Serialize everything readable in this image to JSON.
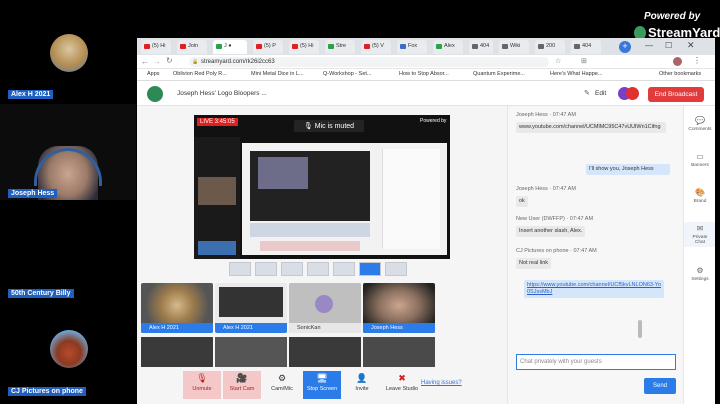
{
  "overlay": {
    "powered_by": "Powered by",
    "brand": "StreamYard"
  },
  "participants": [
    {
      "name": "Alex H 2021"
    },
    {
      "name": "Joseph Hess"
    },
    {
      "name": "50th Century Billy"
    },
    {
      "name": "CJ Pictures on phone"
    }
  ],
  "browser": {
    "tabs": [
      {
        "label": "(5) Hi",
        "fav": "#e02020"
      },
      {
        "label": "Join",
        "fav": "#e02020"
      },
      {
        "label": "J ●",
        "fav": "#2aa14b"
      },
      {
        "label": "(5) P",
        "fav": "#e02020"
      },
      {
        "label": "(5) Hi",
        "fav": "#e02020"
      },
      {
        "label": "Stre",
        "fav": "#2aa14b"
      },
      {
        "label": "(5) V",
        "fav": "#e02020"
      },
      {
        "label": "Fox",
        "fav": "#3a6cc7"
      },
      {
        "label": "Alex",
        "fav": "#2aa14b"
      },
      {
        "label": "404",
        "fav": "#666"
      },
      {
        "label": "Wiki",
        "fav": "#666"
      },
      {
        "label": "200",
        "fav": "#666"
      },
      {
        "label": "404",
        "fav": "#666"
      }
    ],
    "url": "streamyard.com/rk26i2cc63",
    "bookmarks": [
      "Apps",
      "Oblivion Red Poly R...",
      "Mini Metal Dice in L...",
      "Q-Workshop - Set...",
      "How to Stop Absor...",
      "Quantum Experime...",
      "Here's What Happe...",
      "Other bookmarks"
    ]
  },
  "studio": {
    "title": "Joseph Hess' Logo Bloopers ...",
    "edit": "Edit",
    "end_broadcast": "End Broadcast",
    "live_timer": "LIVE 3:45:05",
    "mic_muted": "Mic is muted",
    "tiles": [
      {
        "name": "Alex H 2021"
      },
      {
        "name": "Alex H 2021"
      },
      {
        "name": "SonicKan"
      },
      {
        "name": "Joseph Hess"
      }
    ],
    "controls": [
      {
        "label": "Unmute",
        "icon": "🎙"
      },
      {
        "label": "Start Cam",
        "icon": "🎥"
      },
      {
        "label": "Cam/Mic",
        "icon": "⚙"
      },
      {
        "label": "Stop Screen",
        "icon": "🖥"
      },
      {
        "label": "Invite",
        "icon": "👤"
      },
      {
        "label": "Leave Studio",
        "icon": "✖"
      }
    ],
    "having_issues": "Having issues?"
  },
  "chat": {
    "messages": [
      {
        "sender": "Joseph Hess",
        "time": "07:47 AM",
        "text": "www.youtube.com/channel/UCMlMC95C47vUUlWn1Cifng"
      },
      {
        "text": "I'll show you, Joseph Hess",
        "mine": true
      },
      {
        "sender": "Joseph Hess",
        "time": "07:47 AM",
        "text": "ok"
      },
      {
        "sender": "New User (DWFFP)",
        "time": "07:47 AM",
        "text": "Insert another slash, Alex."
      },
      {
        "sender": "CJ Pictures on phone",
        "time": "07:47 AM",
        "text": "Not real link"
      },
      {
        "text": "https://www.youtube.com/channel/UCf5kvLNLON63-Yo0SJssMbJ",
        "mine": true
      }
    ],
    "input_placeholder": "Chat privately with your guests",
    "send": "Send"
  },
  "side_menu": [
    {
      "label": "Comments",
      "icon": "💬"
    },
    {
      "label": "Banners",
      "icon": "▭"
    },
    {
      "label": "Brand",
      "icon": "🎨"
    },
    {
      "label": "Private Chat",
      "icon": "✉"
    },
    {
      "label": "Settings",
      "icon": "⚙"
    }
  ]
}
